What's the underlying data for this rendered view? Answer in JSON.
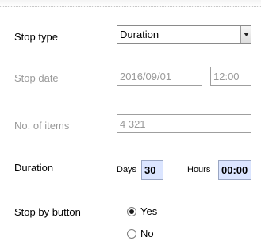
{
  "stop_type": {
    "label": "Stop type",
    "value": "Duration"
  },
  "stop_date": {
    "label": "Stop date",
    "date": "2016/09/01",
    "time": "12:00"
  },
  "items": {
    "label": "No. of items",
    "value": "4 321"
  },
  "duration": {
    "label": "Duration",
    "days_label": "Days",
    "days_value": "30",
    "hours_label": "Hours",
    "hours_value": "00:00"
  },
  "stop_by_button": {
    "label": "Stop by button",
    "options": [
      "Yes",
      "No"
    ],
    "selected": "Yes"
  }
}
